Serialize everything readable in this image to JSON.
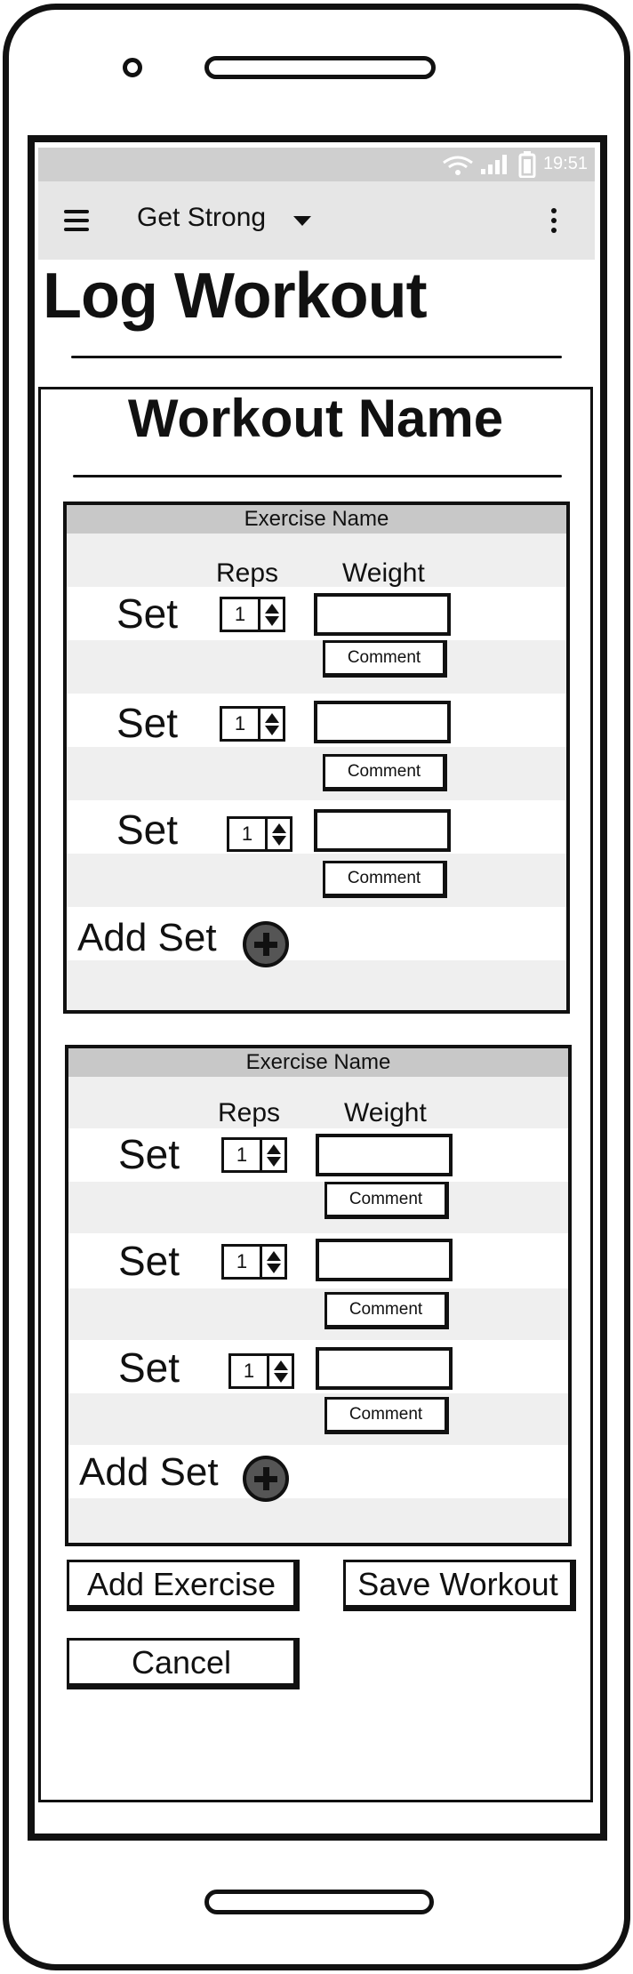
{
  "status_bar": {
    "time": "19:51"
  },
  "app_bar": {
    "title": "Get Strong"
  },
  "page": {
    "title": "Log Workout"
  },
  "workout": {
    "name": "Workout Name"
  },
  "exercises": [
    {
      "name": "Exercise Name",
      "reps_label": "Reps",
      "weight_label": "Weight",
      "sets": [
        {
          "label": "Set",
          "reps": "1",
          "weight": "",
          "comment_label": "Comment"
        },
        {
          "label": "Set",
          "reps": "1",
          "weight": "",
          "comment_label": "Comment"
        },
        {
          "label": "Set",
          "reps": "1",
          "weight": "",
          "comment_label": "Comment"
        }
      ],
      "add_set_label": "Add Set"
    },
    {
      "name": "Exercise Name",
      "reps_label": "Reps",
      "weight_label": "Weight",
      "sets": [
        {
          "label": "Set",
          "reps": "1",
          "weight": "",
          "comment_label": "Comment"
        },
        {
          "label": "Set",
          "reps": "1",
          "weight": "",
          "comment_label": "Comment"
        },
        {
          "label": "Set",
          "reps": "1",
          "weight": "",
          "comment_label": "Comment"
        }
      ],
      "add_set_label": "Add Set"
    }
  ],
  "actions": {
    "add_exercise": "Add Exercise",
    "save_workout": "Save Workout",
    "cancel": "Cancel"
  },
  "icons": {
    "menu": "hamburger-menu-icon",
    "dropdown": "caret-down-icon",
    "overflow": "more-vertical-icon",
    "add": "plus-circle-icon",
    "wifi": "wifi-icon",
    "signal": "signal-icon",
    "battery": "battery-icon"
  }
}
